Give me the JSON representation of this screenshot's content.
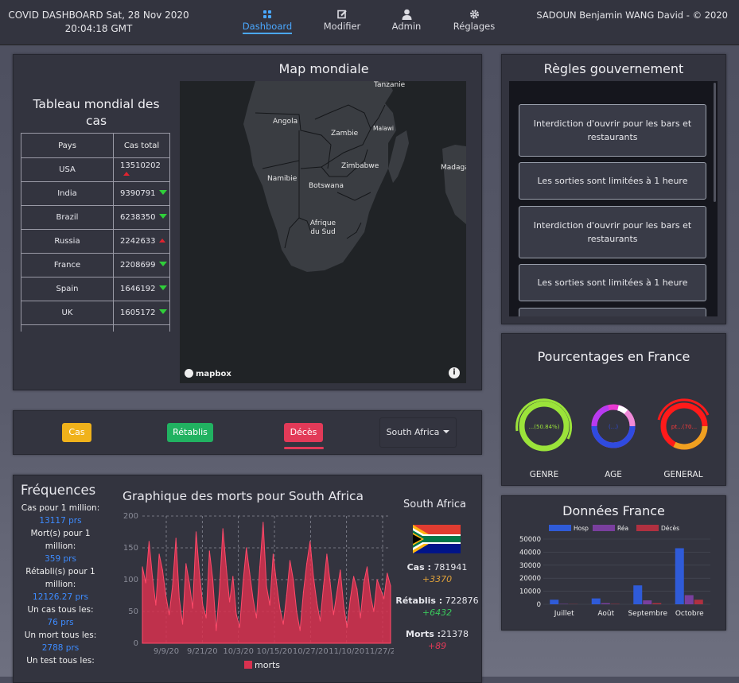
{
  "header": {
    "title": "COVID DASHBOARD Sat, 28 Nov 2020 20:04:18 GMT",
    "nav": [
      {
        "label": "Dashboard",
        "icon": "dashboard-icon",
        "active": true
      },
      {
        "label": "Modifier",
        "icon": "edit-icon"
      },
      {
        "label": "Admin",
        "icon": "user-icon"
      },
      {
        "label": "Réglages",
        "icon": "gear-icon"
      }
    ],
    "credits": "SADOUN Benjamin WANG David - © 2020"
  },
  "world_table": {
    "title": "Tableau mondial des cas",
    "columns": [
      "Pays",
      "Cas total"
    ],
    "rows": [
      {
        "country": "USA",
        "cases": "13510202",
        "trend": "up"
      },
      {
        "country": "India",
        "cases": "9390791",
        "trend": "down"
      },
      {
        "country": "Brazil",
        "cases": "6238350",
        "trend": "down"
      },
      {
        "country": "Russia",
        "cases": "2242633",
        "trend": "up"
      },
      {
        "country": "France",
        "cases": "2208699",
        "trend": "down"
      },
      {
        "country": "Spain",
        "cases": "1646192",
        "trend": "down"
      },
      {
        "country": "UK",
        "cases": "1605172",
        "trend": "down"
      }
    ]
  },
  "map": {
    "title": "Map mondiale",
    "labels": [
      "Tanzanie",
      "Angola",
      "Zambie",
      "Malawi",
      "Madaga",
      "Zimbabwe",
      "Namibie",
      "Botswana",
      "Afrique du Sud"
    ],
    "attribution": "mapbox"
  },
  "rules": {
    "title": "Règles gouvernement",
    "items": [
      "Interdiction d'ouvrir pour les bars et restaurants",
      "Les sorties sont limitées à 1 heure",
      "Interdiction d'ouvrir pour les bars et restaurants",
      "Les sorties sont limitées à 1 heure"
    ]
  },
  "percentages": {
    "title": "Pourcentages en France",
    "donuts": [
      {
        "label": "GENRE",
        "center": "...(50.84%)"
      },
      {
        "label": "AGE",
        "center": "(...)"
      },
      {
        "label": "GENERAL",
        "center": "pt...(70..."
      }
    ]
  },
  "filters": {
    "cas": "Cas",
    "retablis": "Rétablis",
    "deces": "Décès",
    "country": "South Africa"
  },
  "frequencies": {
    "title": "Fréquences",
    "items": [
      {
        "label": "Cas pour 1 million:",
        "value": "13117 prs"
      },
      {
        "label": "Mort(s) pour 1 million:",
        "value": "359 prs"
      },
      {
        "label": "Rétabli(s) pour 1 million:",
        "value": "12126.27 prs"
      },
      {
        "label": "Un cas tous les:",
        "value": "76 prs"
      },
      {
        "label": "Un mort tous les:",
        "value": "2788 prs"
      },
      {
        "label": "Un test tous les:",
        "value": ""
      }
    ]
  },
  "chart_data": [
    {
      "type": "area",
      "title": "Graphique des morts pour South Africa",
      "xlabel": "",
      "ylabel": "",
      "ylim": [
        0,
        200
      ],
      "yticks": [
        0,
        50,
        100,
        150,
        200
      ],
      "xticks": [
        "9/9/20",
        "9/21/20",
        "10/3/20",
        "10/15/20",
        "10/27/20",
        "11/10/20",
        "11/27/20"
      ],
      "series": [
        {
          "name": "morts",
          "color": "#d8314f",
          "values": [
            120,
            95,
            160,
            105,
            60,
            140,
            115,
            75,
            45,
            90,
            165,
            70,
            30,
            125,
            95,
            55,
            175,
            110,
            60,
            40,
            145,
            100,
            20,
            85,
            180,
            120,
            65,
            105,
            45,
            25,
            95,
            150,
            110,
            70,
            40,
            120,
            190,
            90,
            60,
            140,
            95,
            55,
            30,
            75,
            130,
            100,
            50,
            20,
            80,
            125,
            160,
            105,
            65,
            35,
            90,
            140,
            95,
            45,
            80,
            115,
            60,
            25,
            70,
            105,
            85,
            40,
            95,
            120,
            75,
            50,
            100,
            85,
            70,
            110,
            90
          ]
        }
      ],
      "legend": "bottom",
      "grid": true
    },
    {
      "type": "bar",
      "title": "Données France",
      "categories": [
        "Juillet",
        "Août",
        "Septembre",
        "Octobre"
      ],
      "ylim": [
        0,
        50000
      ],
      "yticks": [
        0,
        10000,
        20000,
        30000,
        40000,
        50000
      ],
      "series": [
        {
          "name": "Hosp",
          "color": "#2f5bd8",
          "values": [
            3500,
            4500,
            14500,
            43000
          ]
        },
        {
          "name": "Réa",
          "color": "#7a3f9e",
          "values": [
            300,
            900,
            3000,
            7000
          ]
        },
        {
          "name": "Décès",
          "color": "#b03040",
          "values": [
            150,
            250,
            900,
            3500
          ]
        }
      ],
      "legend": "top"
    }
  ],
  "south_africa": {
    "title": "South Africa",
    "cas_label": "Cas :",
    "cas_value": "781941",
    "cas_delta": "+3370",
    "ret_label": "Rétablis :",
    "ret_value": "722876",
    "ret_delta": "+6432",
    "morts_label": "Morts :",
    "morts_value": "21378",
    "morts_delta": "+89"
  }
}
